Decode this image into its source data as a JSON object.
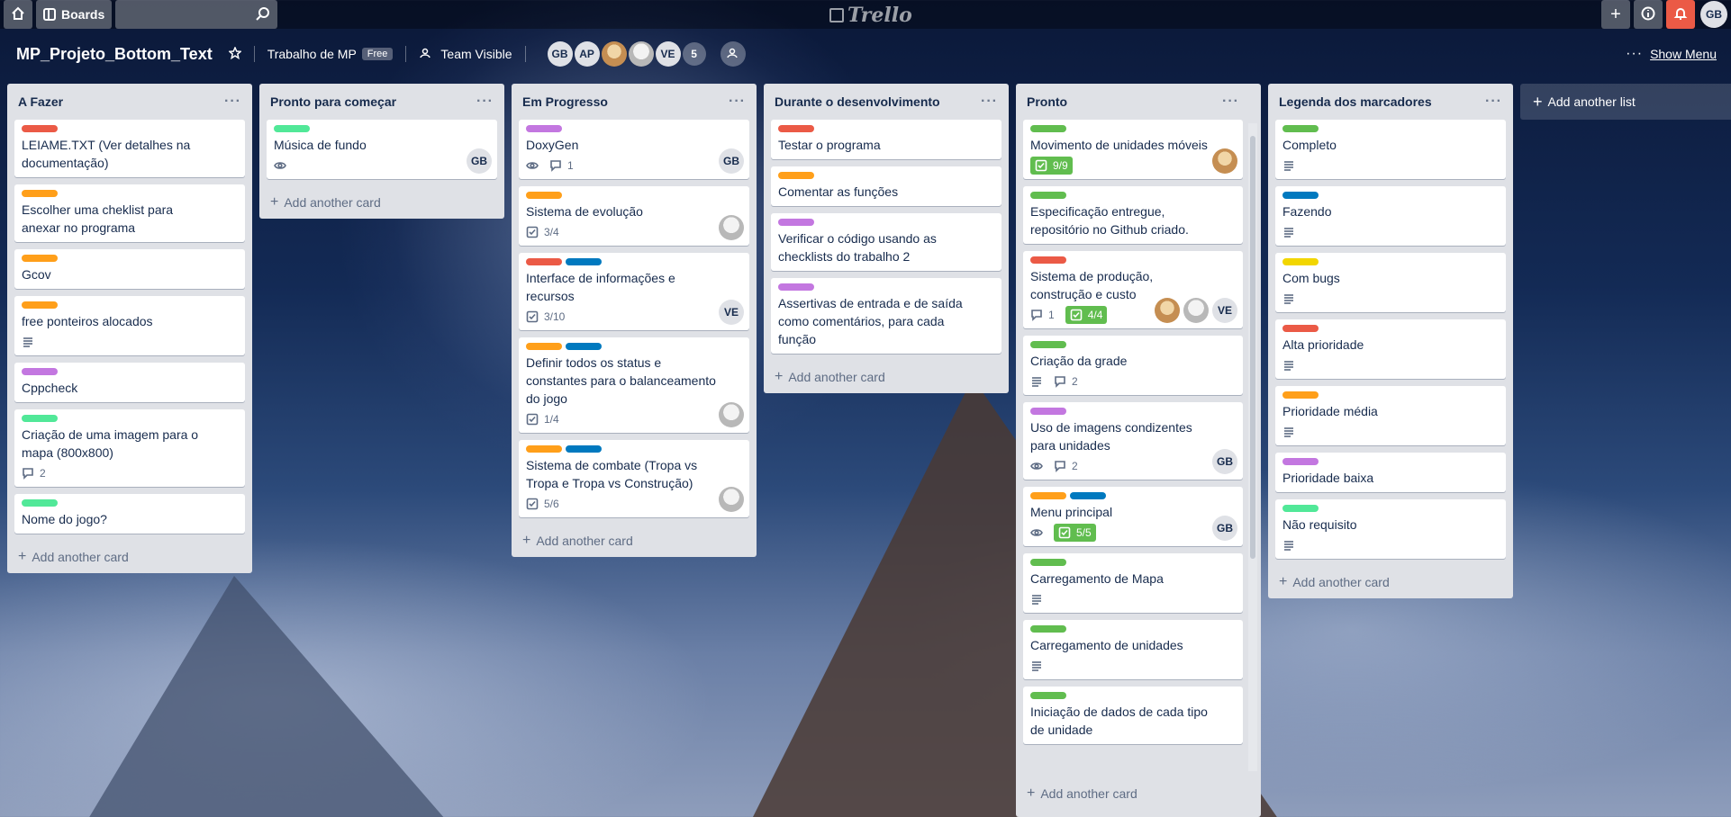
{
  "topbar": {
    "boards_label": "Boards",
    "logo_text": "Trello",
    "user_initials": "GB"
  },
  "board": {
    "title": "MP_Projeto_Bottom_Text",
    "team_name": "Trabalho de MP",
    "team_badge": "Free",
    "visibility": "Team Visible",
    "members": [
      "GB",
      "AP",
      "",
      "",
      "VE"
    ],
    "members_more": "5",
    "show_menu": "Show Menu"
  },
  "add_another_card": "Add another card",
  "add_another_list": "Add another list",
  "colors": {
    "green": "#61bd4f",
    "red": "#eb5a46",
    "orange": "#ff9f1a",
    "purple": "#c377e0",
    "blue": "#0079bf",
    "yellow": "#f2d600",
    "lime": "#51e898"
  },
  "lists": [
    {
      "name": "A Fazer",
      "cards": [
        {
          "labels": [
            "red"
          ],
          "title": "LEIAME.TXT (Ver detalhes na documentação)",
          "badges": [],
          "members": []
        },
        {
          "labels": [
            "orange"
          ],
          "title": "Escolher uma cheklist para anexar no programa",
          "badges": [],
          "members": []
        },
        {
          "labels": [
            "orange"
          ],
          "title": "Gcov",
          "badges": [],
          "members": []
        },
        {
          "labels": [
            "orange"
          ],
          "title": "free ponteiros alocados",
          "badges": [
            {
              "icon": "description-icon",
              "text": ""
            }
          ],
          "members": []
        },
        {
          "labels": [
            "purple"
          ],
          "title": "Cppcheck",
          "badges": [],
          "members": []
        },
        {
          "labels": [
            "lime"
          ],
          "title": "Criação de uma imagem para o mapa (800x800)",
          "badges": [
            {
              "icon": "comment-icon",
              "text": "2"
            }
          ],
          "members": []
        },
        {
          "labels": [
            "lime"
          ],
          "title": "Nome do jogo?",
          "badges": [],
          "members": []
        }
      ]
    },
    {
      "name": "Pronto para começar",
      "cards": [
        {
          "labels": [
            "lime"
          ],
          "title": "Música de fundo",
          "badges": [
            {
              "icon": "watch-icon",
              "text": ""
            }
          ],
          "members": [
            "GB"
          ]
        }
      ]
    },
    {
      "name": "Em Progresso",
      "cards": [
        {
          "labels": [
            "purple"
          ],
          "title": "DoxyGen",
          "badges": [
            {
              "icon": "watch-icon",
              "text": ""
            },
            {
              "icon": "comment-icon",
              "text": "1"
            }
          ],
          "members": [
            "GB"
          ]
        },
        {
          "labels": [
            "orange"
          ],
          "title": "Sistema de evolução",
          "badges": [
            {
              "icon": "checklist-icon",
              "text": "3/4"
            }
          ],
          "members": [
            "img2"
          ]
        },
        {
          "labels": [
            "red",
            "blue"
          ],
          "title": "Interface de informações e recursos",
          "badges": [
            {
              "icon": "checklist-icon",
              "text": "3/10"
            }
          ],
          "members": [
            "VE"
          ]
        },
        {
          "labels": [
            "orange",
            "blue"
          ],
          "title": "Definir todos os status e constantes para o balanceamento do jogo",
          "badges": [
            {
              "icon": "checklist-icon",
              "text": "1/4"
            }
          ],
          "members": [
            "img2"
          ]
        },
        {
          "labels": [
            "orange",
            "blue"
          ],
          "title": "Sistema de combate (Tropa vs Tropa e Tropa vs Construção)",
          "badges": [
            {
              "icon": "checklist-icon",
              "text": "5/6"
            }
          ],
          "members": [
            "img2"
          ]
        }
      ]
    },
    {
      "name": "Durante o desenvolvimento",
      "cards": [
        {
          "labels": [
            "red"
          ],
          "title": "Testar o programa",
          "badges": [],
          "members": []
        },
        {
          "labels": [
            "orange"
          ],
          "title": "Comentar as funções",
          "badges": [],
          "members": []
        },
        {
          "labels": [
            "purple"
          ],
          "title": "Verificar o código usando as checklists do trabalho 2",
          "badges": [],
          "members": []
        },
        {
          "labels": [
            "purple"
          ],
          "title": "Assertivas de entrada e de saída como comentários, para cada função",
          "badges": [],
          "members": []
        }
      ]
    },
    {
      "name": "Pronto",
      "cards": [
        {
          "labels": [
            "green"
          ],
          "title": "Movimento de unidades móveis",
          "badges": [
            {
              "icon": "checklist-icon",
              "text": "9/9",
              "done": true
            }
          ],
          "members": [
            "img"
          ]
        },
        {
          "labels": [
            "green"
          ],
          "title": "Especificação entregue, repositório no Github criado.",
          "badges": [],
          "members": []
        },
        {
          "labels": [
            "red"
          ],
          "title": "Sistema de produção, construção e custo",
          "badges": [
            {
              "icon": "comment-icon",
              "text": "1"
            },
            {
              "icon": "checklist-icon",
              "text": "4/4",
              "done": true
            }
          ],
          "members": [
            "img",
            "img2",
            "VE"
          ]
        },
        {
          "labels": [
            "green"
          ],
          "title": "Criação da grade",
          "badges": [
            {
              "icon": "description-icon",
              "text": ""
            },
            {
              "icon": "comment-icon",
              "text": "2"
            }
          ],
          "members": []
        },
        {
          "labels": [
            "purple"
          ],
          "title": "Uso de imagens condizentes para unidades",
          "badges": [
            {
              "icon": "watch-icon",
              "text": ""
            },
            {
              "icon": "comment-icon",
              "text": "2"
            }
          ],
          "members": [
            "GB"
          ]
        },
        {
          "labels": [
            "orange",
            "blue"
          ],
          "title": "Menu principal",
          "badges": [
            {
              "icon": "watch-icon",
              "text": ""
            },
            {
              "icon": "checklist-icon",
              "text": "5/5",
              "done": true
            }
          ],
          "members": [
            "GB"
          ]
        },
        {
          "labels": [
            "green"
          ],
          "title": "Carregamento de Mapa",
          "badges": [
            {
              "icon": "description-icon",
              "text": ""
            }
          ],
          "members": []
        },
        {
          "labels": [
            "green"
          ],
          "title": "Carregamento de unidades",
          "badges": [
            {
              "icon": "description-icon",
              "text": ""
            }
          ],
          "members": []
        },
        {
          "labels": [
            "green"
          ],
          "title": "Iniciação de dados de cada tipo de unidade",
          "badges": [],
          "members": []
        }
      ]
    },
    {
      "name": "Legenda dos marcadores",
      "cards": [
        {
          "labels": [
            "green"
          ],
          "title": "Completo",
          "badges": [
            {
              "icon": "description-icon",
              "text": ""
            }
          ],
          "members": []
        },
        {
          "labels": [
            "blue"
          ],
          "title": "Fazendo",
          "badges": [
            {
              "icon": "description-icon",
              "text": ""
            }
          ],
          "members": []
        },
        {
          "labels": [
            "yellow"
          ],
          "title": "Com bugs",
          "badges": [
            {
              "icon": "description-icon",
              "text": ""
            }
          ],
          "members": []
        },
        {
          "labels": [
            "red"
          ],
          "title": "Alta prioridade",
          "badges": [
            {
              "icon": "description-icon",
              "text": ""
            }
          ],
          "members": []
        },
        {
          "labels": [
            "orange"
          ],
          "title": "Prioridade média",
          "badges": [
            {
              "icon": "description-icon",
              "text": ""
            }
          ],
          "members": []
        },
        {
          "labels": [
            "purple"
          ],
          "title": "Prioridade baixa",
          "badges": [],
          "members": []
        },
        {
          "labels": [
            "lime"
          ],
          "title": "Não requisito",
          "badges": [
            {
              "icon": "description-icon",
              "text": ""
            }
          ],
          "members": []
        }
      ]
    }
  ]
}
